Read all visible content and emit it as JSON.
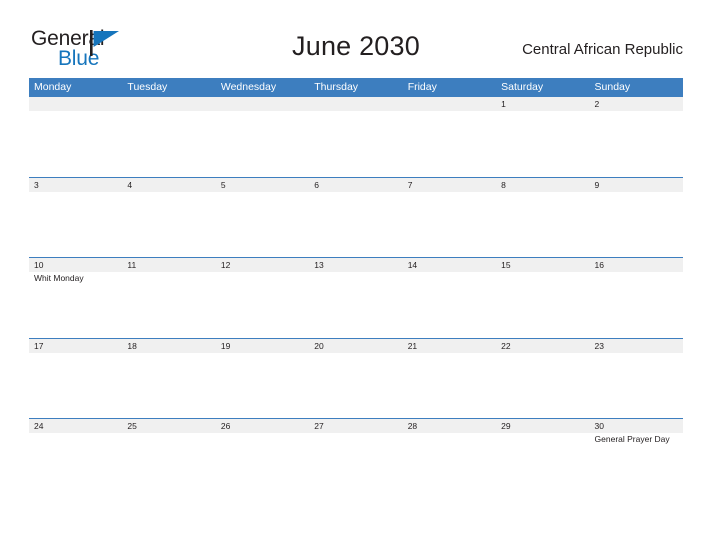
{
  "brand": {
    "name_part1": "General",
    "name_part2": "Blue"
  },
  "header": {
    "title": "June 2030",
    "country": "Central African Republic"
  },
  "colors": {
    "header_blue": "#3d7ebf",
    "brand_blue": "#1675bc",
    "row_band": "#f0f0f0",
    "text": "#231f20"
  },
  "weekdays": [
    {
      "label": "Monday"
    },
    {
      "label": "Tuesday"
    },
    {
      "label": "Wednesday"
    },
    {
      "label": "Thursday"
    },
    {
      "label": "Friday"
    },
    {
      "label": "Saturday"
    },
    {
      "label": "Sunday"
    }
  ],
  "weeks": [
    {
      "days": [
        {
          "num": "",
          "event": ""
        },
        {
          "num": "",
          "event": ""
        },
        {
          "num": "",
          "event": ""
        },
        {
          "num": "",
          "event": ""
        },
        {
          "num": "",
          "event": ""
        },
        {
          "num": "1",
          "event": ""
        },
        {
          "num": "2",
          "event": ""
        }
      ]
    },
    {
      "days": [
        {
          "num": "3",
          "event": ""
        },
        {
          "num": "4",
          "event": ""
        },
        {
          "num": "5",
          "event": ""
        },
        {
          "num": "6",
          "event": ""
        },
        {
          "num": "7",
          "event": ""
        },
        {
          "num": "8",
          "event": ""
        },
        {
          "num": "9",
          "event": ""
        }
      ]
    },
    {
      "days": [
        {
          "num": "10",
          "event": "Whit Monday"
        },
        {
          "num": "11",
          "event": ""
        },
        {
          "num": "12",
          "event": ""
        },
        {
          "num": "13",
          "event": ""
        },
        {
          "num": "14",
          "event": ""
        },
        {
          "num": "15",
          "event": ""
        },
        {
          "num": "16",
          "event": ""
        }
      ]
    },
    {
      "days": [
        {
          "num": "17",
          "event": ""
        },
        {
          "num": "18",
          "event": ""
        },
        {
          "num": "19",
          "event": ""
        },
        {
          "num": "20",
          "event": ""
        },
        {
          "num": "21",
          "event": ""
        },
        {
          "num": "22",
          "event": ""
        },
        {
          "num": "23",
          "event": ""
        }
      ]
    },
    {
      "days": [
        {
          "num": "24",
          "event": ""
        },
        {
          "num": "25",
          "event": ""
        },
        {
          "num": "26",
          "event": ""
        },
        {
          "num": "27",
          "event": ""
        },
        {
          "num": "28",
          "event": ""
        },
        {
          "num": "29",
          "event": ""
        },
        {
          "num": "30",
          "event": "General Prayer Day"
        }
      ]
    }
  ]
}
